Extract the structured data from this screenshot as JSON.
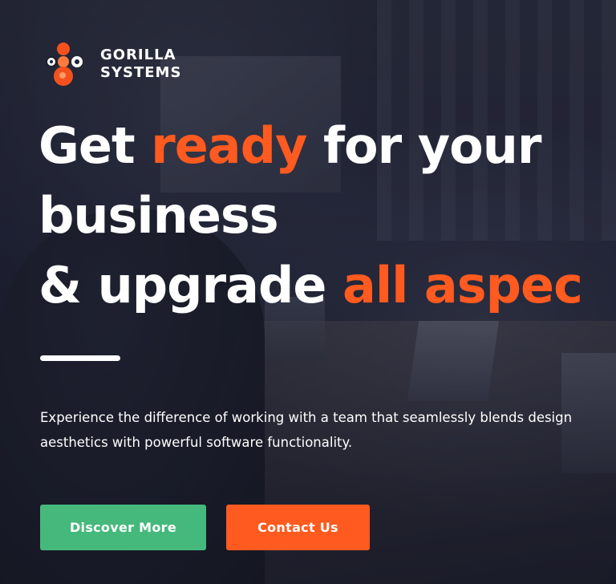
{
  "brand": {
    "name_line1": "GORILLA",
    "name_line2": "SYSTEMS",
    "logo_icon": "gorilla-systems-logo-icon"
  },
  "hero": {
    "headline": {
      "part1": "Get ",
      "accent1": "ready",
      "part2": " for your",
      "line2": "business",
      "part3": "& upgrade ",
      "accent2": "all aspec"
    },
    "subtitle": "Experience the difference of working with a team that seamlessly blends design aesthetics with powerful software functionality.",
    "buttons": {
      "discover_label": "Discover More",
      "contact_label": "Contact Us"
    }
  },
  "colors": {
    "accent_orange": "#ff5a1f",
    "accent_green": "#45b97c",
    "text": "#ffffff",
    "background": "#1c1f2e"
  }
}
